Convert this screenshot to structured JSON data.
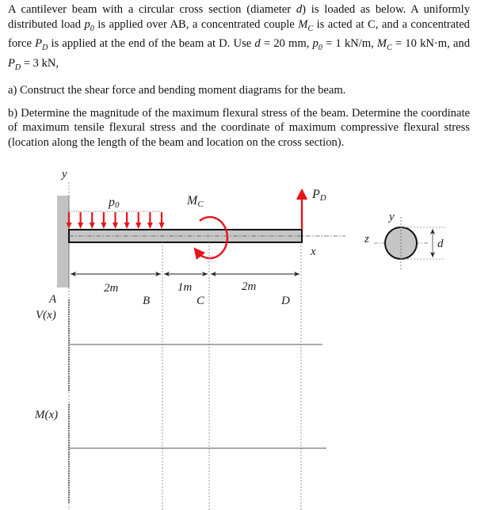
{
  "problem": {
    "intro": {
      "t1": "A cantilever beam with a circular cross section (diameter ",
      "d": "d",
      "t2": ") is loaded as below. A uniformly distributed load ",
      "p0": "p",
      "p0_sub": "0",
      "t3": " is applied over AB, a concentrated couple ",
      "mc": "M",
      "mc_sub": "C",
      "t4": " is acted at C, and a concentrated force ",
      "pd": "P",
      "pd_sub": "D",
      "t5": " is applied at the end of the beam at D. Use ",
      "d2": "d",
      "t6": " = 20 mm, ",
      "p02": "p",
      "p02_sub": "0",
      "t7": " = 1 kN/m, ",
      "mc2": "M",
      "mc2_sub": "C",
      "t8": " = 10 kN·m, and ",
      "pd2": "P",
      "pd2_sub": "D",
      "t9": " = 3 kN,"
    },
    "part_a": "a) Construct the shear force and bending moment diagrams for the beam.",
    "part_b": "b) Determine the magnitude of the maximum flexural stress of the beam. Determine the coordinate of maximum tensile flexural stress and the coordinate of maximum compressive flexural stress (location along the length of the beam and location on the cross section)."
  },
  "figure": {
    "axis_y": "y",
    "axis_x": "x",
    "load_label": "p",
    "load_sub": "0",
    "couple_label": "M",
    "couple_sub": "C",
    "force_label": "P",
    "force_sub": "D",
    "points": {
      "A": "A",
      "B": "B",
      "C": "C",
      "D": "D"
    },
    "dims": {
      "AB": "2m",
      "BC": "1m",
      "CD": "2m"
    },
    "shear_label": "V(x)",
    "moment_label": "M(x)",
    "section": {
      "y": "y",
      "z": "z",
      "d": "d"
    },
    "load_color": "#e8141b"
  }
}
